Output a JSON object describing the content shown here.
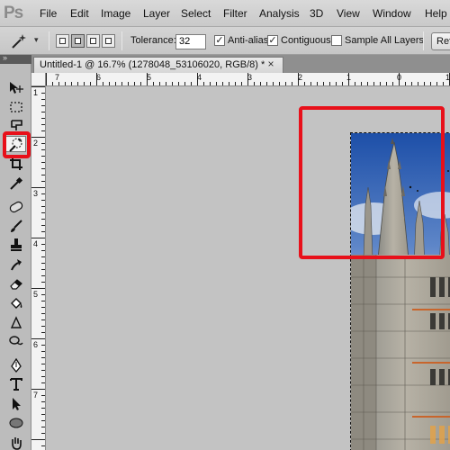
{
  "app": {
    "logo": "Ps"
  },
  "menu": [
    "File",
    "Edit",
    "Image",
    "Layer",
    "Select",
    "Filter",
    "Analysis",
    "3D",
    "View",
    "Window",
    "Help"
  ],
  "options": {
    "tolerance_label": "Tolerance:",
    "tolerance_value": "32",
    "anti_alias_label": "Anti-alias",
    "anti_alias_checked": true,
    "contiguous_label": "Contiguous",
    "contiguous_checked": true,
    "sample_all_layers_label": "Sample All Layers",
    "sample_all_layers_checked": false,
    "refine_edge_label": "Refine Edge..."
  },
  "document": {
    "tab_title": "Untitled-1 @ 16.7% (1278048_53106020, RGB/8) *",
    "close_glyph": "×"
  },
  "rulers": {
    "top": [
      "7",
      "6",
      "5",
      "4",
      "3",
      "2",
      "1",
      "0",
      "1"
    ],
    "left": [
      "1",
      "2",
      "3",
      "4",
      "5",
      "6",
      "7"
    ]
  },
  "colors": {
    "highlight": "#e8101a",
    "menubar": "#d0d0d0",
    "canvas_bg": "#c3c3c3"
  },
  "tools": [
    "move-icon",
    "rectangular-marquee-icon",
    "quick-selection-icon",
    "magic-wand-icon",
    "crop-icon",
    "eyedropper-icon",
    "spot-healing-brush-icon",
    "brush-icon",
    "clone-stamp-icon",
    "history-brush-icon",
    "eraser-icon",
    "paint-bucket-icon",
    "blur-icon",
    "dodge-icon",
    "pen-icon",
    "type-icon",
    "path-selection-icon",
    "ellipse-icon",
    "hand-icon"
  ]
}
